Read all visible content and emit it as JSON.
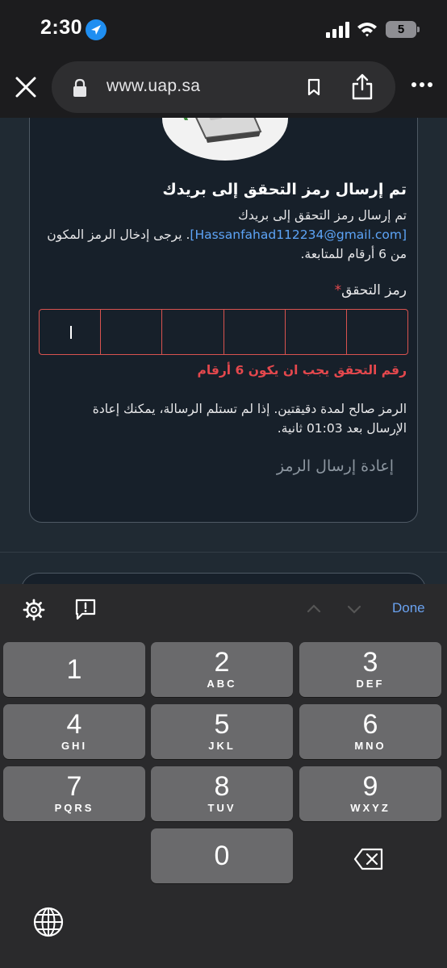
{
  "status_bar": {
    "time": "2:30",
    "battery": "5",
    "icons": [
      "location-arrow-icon",
      "cellular-signal-icon",
      "wifi-icon",
      "battery-icon"
    ]
  },
  "browser": {
    "url": "www.uap.sa",
    "icons": [
      "close-icon",
      "lock-icon",
      "bookmark-icon",
      "share-icon",
      "more-icon"
    ]
  },
  "verification": {
    "title": "تم إرسال رمز التحقق إلى بريدك",
    "desc_prefix": "تم إرسال رمز التحقق إلى بريدك",
    "email": "[Hassanfahad112234@gmail.com]",
    "desc_suffix": ". يرجى إدخال الرمز المكون من 6 أرقام للمتابعة.",
    "code_label": "رمز التحقق",
    "required_mark": "*",
    "error": "رقم التحقق يجب ان يكون 6 أرقام",
    "info": "الرمز صالح لمدة دقيقتين. إذا لم تستلم الرسالة، يمكنك إعادة الإرسال بعد 01:03 ثانية.",
    "resend": "إعادة إرسال الرمز"
  },
  "accessory": {
    "done": "Done",
    "icons": [
      "gear-icon",
      "feedback-icon",
      "chevron-up-icon",
      "chevron-down-icon"
    ]
  },
  "keyboard": {
    "keys": [
      {
        "num": "1",
        "letters": ""
      },
      {
        "num": "2",
        "letters": "ABC"
      },
      {
        "num": "3",
        "letters": "DEF"
      },
      {
        "num": "4",
        "letters": "GHI"
      },
      {
        "num": "5",
        "letters": "JKL"
      },
      {
        "num": "6",
        "letters": "MNO"
      },
      {
        "num": "7",
        "letters": "PQRS"
      },
      {
        "num": "8",
        "letters": "TUV"
      },
      {
        "num": "9",
        "letters": "WXYZ"
      },
      {
        "num": "0",
        "letters": ""
      }
    ],
    "icons": [
      "backspace-icon",
      "globe-icon"
    ]
  },
  "colors": {
    "accent_link": "#5da4f7",
    "error": "#e5484d",
    "done": "#6aa2f0",
    "page_bg": "#202a33",
    "card_bg": "#17202a"
  }
}
